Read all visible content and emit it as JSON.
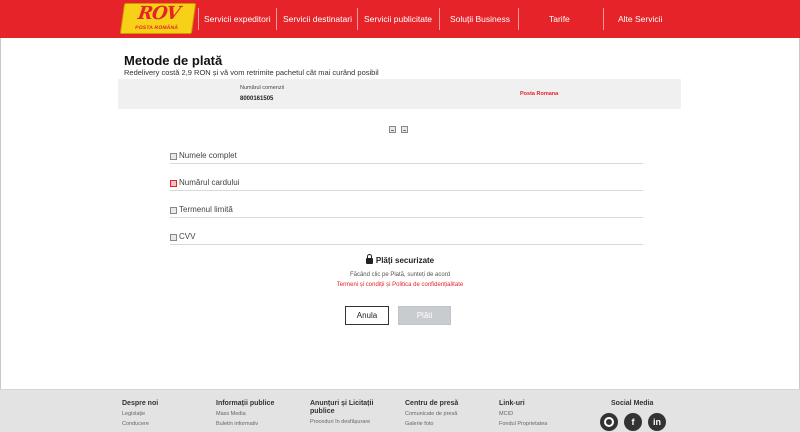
{
  "colors": {
    "brand_red": "#e52329",
    "logo_yellow": "#f7d117",
    "footer_bg": "#e3e3e3",
    "disabled_button": "#c8ccd1"
  },
  "header": {
    "logo_mark": "ROV",
    "logo_sub": "POSTA ROMÂNĂ",
    "nav": [
      "Servicii expeditori",
      "Servicii destinatari",
      "Servicii publicitate",
      "Soluții Business",
      "Tarife",
      "Alte Servicii"
    ]
  },
  "main": {
    "title": "Metode de plată",
    "subtitle": "Redelivery costă 2,9 RON și vă vom retrimite pachetul cât mai curând posibil",
    "order": {
      "label": "Numărul comenzii",
      "value": "8000161505",
      "brand": "Posta Romana"
    },
    "card_icons": [
      "card-icon",
      "card-icon"
    ],
    "fields": [
      {
        "label": "Numele complet",
        "icon": "broken-image-icon"
      },
      {
        "label": "Numărul cardului",
        "icon": "card-number-icon"
      },
      {
        "label": "Termenul limită",
        "icon": "broken-image-icon"
      },
      {
        "label": "CVV",
        "icon": "broken-image-icon"
      }
    ],
    "secure_text": "Plăți securizate",
    "terms_intro": "Făcând clic pe Plată, sunteți de acord",
    "terms_link": "Termeni și condiții și Politica de confidențialitate",
    "buttons": {
      "cancel": "Anula",
      "pay": "Plăti"
    }
  },
  "footer": {
    "columns": [
      {
        "heading": "Despre noi",
        "links": [
          "Legislație",
          "Conducere"
        ]
      },
      {
        "heading": "Informații publice",
        "links": [
          "Mass Media",
          "Buletin informativ"
        ]
      },
      {
        "heading": "Anunțuri și Licitații publice",
        "links": [
          "Proceduri în desfășurare"
        ]
      },
      {
        "heading": "Centru de presă",
        "links": [
          "Comunicate de presă",
          "Galerie foto"
        ]
      },
      {
        "heading": "Link-uri",
        "links": [
          "MCID",
          "Fondul Proprietatea"
        ]
      }
    ],
    "social_heading": "Social Media",
    "social": [
      "instagram-icon",
      "facebook-icon",
      "linkedin-icon"
    ],
    "social_glyphs": [
      "",
      "f",
      "in"
    ]
  }
}
